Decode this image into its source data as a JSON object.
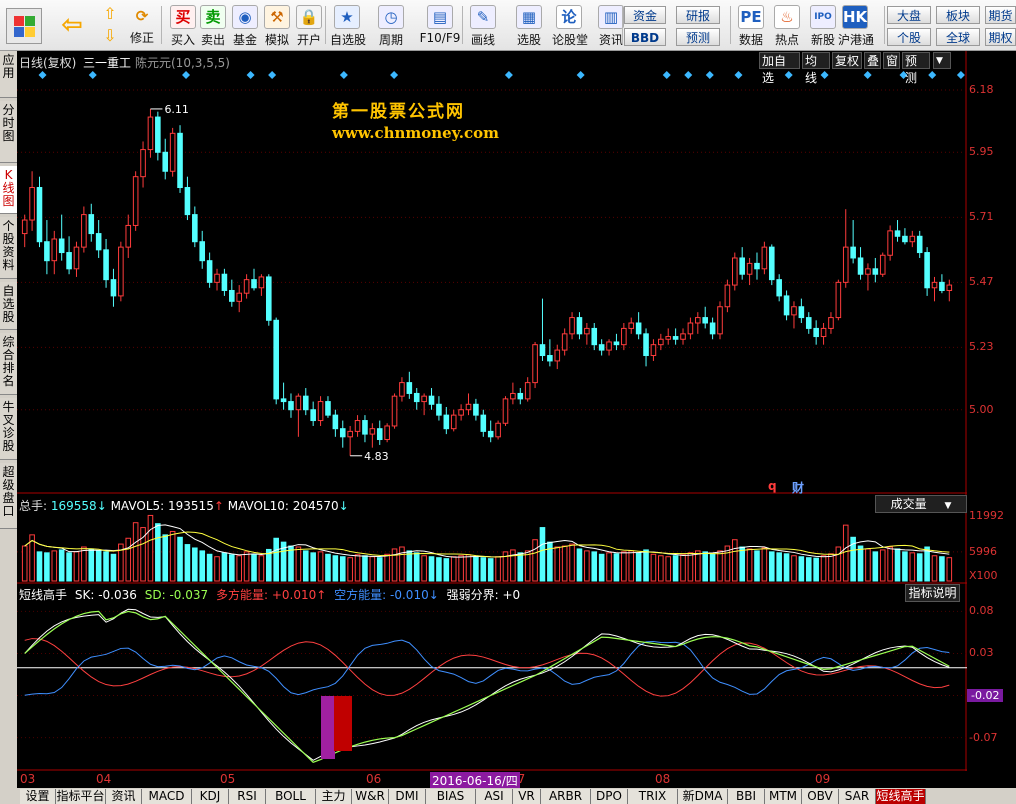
{
  "toolbar": {
    "buttons": [
      "买入",
      "卖出",
      "基金",
      "模拟",
      "开户",
      "自选股",
      "周期",
      "F10/F9",
      "画线",
      "选股",
      "论股堂",
      "资讯",
      "数据",
      "热点",
      "新股",
      "沪港通"
    ],
    "nav_labels": [
      "修正"
    ],
    "funds": "资金",
    "bbd": "BBD",
    "research": "研报",
    "forecast": "预测",
    "market": "大盘",
    "block": "板块",
    "single": "个股",
    "global": "全球",
    "futures": "期货",
    "futures2": "期权",
    "icons": [
      "back-icon",
      "up-icon",
      "down-icon",
      "refresh-icon"
    ]
  },
  "left_tabs": [
    "应用",
    "分时图",
    "K线图",
    "个股资料",
    "自选股",
    "综合排名",
    "牛叉诊股",
    "超级盘口"
  ],
  "header": {
    "period": "日线(复权)",
    "stock": "三一重工",
    "params": "陈元元(10,3,5,5)",
    "buttons": [
      "加自选",
      "均线",
      "复权",
      "叠",
      "窗",
      "预测"
    ]
  },
  "watermark": {
    "line1": "第一股票公式网",
    "line2": "www.chnmoney.com"
  },
  "price": {
    "high_label": "6.11",
    "low_label": "4.83",
    "ticks": [
      "6.18",
      "5.95",
      "5.71",
      "5.47",
      "5.23",
      "5.00"
    ],
    "markers": [
      "q",
      "财"
    ]
  },
  "volume": {
    "label_total": "总手:",
    "total": "169558",
    "mav5_label": "MAVOL5:",
    "mav5": "193515",
    "mav10_label": "MAVOL10:",
    "mav10": "204570",
    "selector": "成交量",
    "ticks": [
      "11992",
      "5996"
    ],
    "unit": "X100"
  },
  "indicator": {
    "name": "短线高手",
    "sk_label": "SK:",
    "sk": "-0.036",
    "sd_label": "SD:",
    "sd": "-0.037",
    "long_label": "多方能量:",
    "long": "+0.010",
    "short_label": "空方能量:",
    "short": "-0.010",
    "split_label": "强弱分界:",
    "split": "+0",
    "help": "指标说明",
    "ticks": [
      "0.08",
      "0.03",
      "-0.02",
      "-0.07"
    ],
    "current": "-0.02"
  },
  "dates": {
    "months": [
      "03",
      "04",
      "05",
      "06",
      "07",
      "08",
      "09"
    ],
    "cursor": "2016-06-16/四"
  },
  "bottom_tabs": [
    "设置",
    "指标平台",
    "资讯",
    "MACD",
    "KDJ",
    "RSI",
    "BOLL",
    "主力",
    "W&R",
    "DMI",
    "BIAS",
    "ASI",
    "VR",
    "ARBR",
    "DPO",
    "TRIX",
    "新DMA",
    "BBI",
    "MTM",
    "OBV",
    "SAR",
    "短线高手"
  ],
  "colors": {
    "up": "#ff3c3c",
    "down": "#54ffff",
    "sk": "#9bff53",
    "sd": "#ffffff",
    "long": "#ff4040",
    "short": "#3f8fff",
    "text_yellow": "#ffcc00"
  },
  "chart_data": {
    "type": "candlestick",
    "price_ylim": [
      4.7,
      6.25
    ],
    "candles": [
      [
        5.65,
        5.72,
        5.6,
        5.7
      ],
      [
        5.7,
        5.88,
        5.66,
        5.82
      ],
      [
        5.82,
        5.86,
        5.6,
        5.62
      ],
      [
        5.62,
        5.7,
        5.5,
        5.55
      ],
      [
        5.55,
        5.66,
        5.5,
        5.63
      ],
      [
        5.63,
        5.72,
        5.55,
        5.58
      ],
      [
        5.58,
        5.64,
        5.5,
        5.52
      ],
      [
        5.52,
        5.62,
        5.49,
        5.6
      ],
      [
        5.6,
        5.75,
        5.58,
        5.72
      ],
      [
        5.72,
        5.76,
        5.62,
        5.65
      ],
      [
        5.65,
        5.7,
        5.56,
        5.59
      ],
      [
        5.59,
        5.63,
        5.45,
        5.48
      ],
      [
        5.48,
        5.52,
        5.38,
        5.42
      ],
      [
        5.42,
        5.62,
        5.4,
        5.6
      ],
      [
        5.6,
        5.72,
        5.56,
        5.68
      ],
      [
        5.68,
        5.88,
        5.66,
        5.86
      ],
      [
        5.86,
        5.99,
        5.82,
        5.96
      ],
      [
        5.96,
        6.11,
        5.93,
        6.08
      ],
      [
        6.08,
        6.1,
        5.92,
        5.95
      ],
      [
        5.95,
        6.0,
        5.85,
        5.88
      ],
      [
        5.88,
        6.04,
        5.86,
        6.02
      ],
      [
        6.02,
        6.05,
        5.8,
        5.82
      ],
      [
        5.82,
        5.86,
        5.7,
        5.72
      ],
      [
        5.72,
        5.75,
        5.6,
        5.62
      ],
      [
        5.62,
        5.66,
        5.52,
        5.55
      ],
      [
        5.55,
        5.58,
        5.45,
        5.47
      ],
      [
        5.47,
        5.52,
        5.44,
        5.5
      ],
      [
        5.5,
        5.52,
        5.42,
        5.44
      ],
      [
        5.44,
        5.48,
        5.38,
        5.4
      ],
      [
        5.4,
        5.46,
        5.36,
        5.43
      ],
      [
        5.43,
        5.5,
        5.41,
        5.48
      ],
      [
        5.48,
        5.52,
        5.44,
        5.45
      ],
      [
        5.45,
        5.5,
        5.42,
        5.49
      ],
      [
        5.49,
        5.5,
        5.31,
        5.33
      ],
      [
        5.33,
        5.34,
        5.02,
        5.04
      ],
      [
        5.04,
        5.1,
        5.0,
        5.03
      ],
      [
        5.03,
        5.06,
        4.97,
        5.0
      ],
      [
        5.0,
        5.06,
        4.9,
        5.05
      ],
      [
        5.05,
        5.08,
        4.98,
        5.0
      ],
      [
        5.0,
        5.03,
        4.94,
        4.96
      ],
      [
        4.96,
        5.05,
        4.94,
        5.03
      ],
      [
        5.03,
        5.05,
        4.97,
        4.98
      ],
      [
        4.98,
        5.0,
        4.9,
        4.93
      ],
      [
        4.93,
        4.96,
        4.86,
        4.9
      ],
      [
        4.9,
        4.94,
        4.83,
        4.92
      ],
      [
        4.92,
        4.98,
        4.9,
        4.96
      ],
      [
        4.96,
        4.98,
        4.88,
        4.91
      ],
      [
        4.91,
        4.95,
        4.86,
        4.93
      ],
      [
        4.93,
        4.96,
        4.87,
        4.89
      ],
      [
        4.89,
        4.95,
        4.88,
        4.94
      ],
      [
        4.94,
        5.06,
        4.93,
        5.05
      ],
      [
        5.05,
        5.12,
        5.03,
        5.1
      ],
      [
        5.1,
        5.14,
        5.04,
        5.06
      ],
      [
        5.06,
        5.08,
        5.0,
        5.03
      ],
      [
        5.03,
        5.06,
        4.98,
        5.05
      ],
      [
        5.05,
        5.08,
        5.0,
        5.02
      ],
      [
        5.02,
        5.05,
        4.96,
        4.98
      ],
      [
        4.98,
        5.01,
        4.91,
        4.93
      ],
      [
        4.93,
        5.0,
        4.92,
        4.98
      ],
      [
        4.98,
        5.02,
        4.96,
        5.0
      ],
      [
        5.0,
        5.06,
        4.98,
        5.02
      ],
      [
        5.02,
        5.04,
        4.96,
        4.98
      ],
      [
        4.98,
        5.0,
        4.9,
        4.92
      ],
      [
        4.92,
        4.96,
        4.88,
        4.9
      ],
      [
        4.9,
        4.96,
        4.89,
        4.95
      ],
      [
        4.95,
        5.05,
        4.94,
        5.04
      ],
      [
        5.04,
        5.1,
        5.02,
        5.06
      ],
      [
        5.06,
        5.08,
        5.02,
        5.04
      ],
      [
        5.04,
        5.12,
        5.03,
        5.1
      ],
      [
        5.1,
        5.25,
        5.08,
        5.24
      ],
      [
        5.24,
        5.41,
        5.18,
        5.2
      ],
      [
        5.2,
        5.26,
        5.16,
        5.18
      ],
      [
        5.18,
        5.24,
        5.15,
        5.22
      ],
      [
        5.22,
        5.3,
        5.2,
        5.28
      ],
      [
        5.28,
        5.36,
        5.26,
        5.34
      ],
      [
        5.34,
        5.36,
        5.26,
        5.28
      ],
      [
        5.28,
        5.32,
        5.24,
        5.3
      ],
      [
        5.3,
        5.32,
        5.22,
        5.24
      ],
      [
        5.24,
        5.26,
        5.2,
        5.22
      ],
      [
        5.22,
        5.26,
        5.2,
        5.25
      ],
      [
        5.25,
        5.28,
        5.22,
        5.24
      ],
      [
        5.24,
        5.32,
        5.22,
        5.3
      ],
      [
        5.3,
        5.34,
        5.28,
        5.32
      ],
      [
        5.32,
        5.36,
        5.26,
        5.28
      ],
      [
        5.28,
        5.3,
        5.16,
        5.2
      ],
      [
        5.2,
        5.26,
        5.18,
        5.24
      ],
      [
        5.24,
        5.28,
        5.22,
        5.26
      ],
      [
        5.26,
        5.3,
        5.24,
        5.27
      ],
      [
        5.27,
        5.3,
        5.24,
        5.26
      ],
      [
        5.26,
        5.3,
        5.24,
        5.28
      ],
      [
        5.28,
        5.34,
        5.26,
        5.32
      ],
      [
        5.32,
        5.36,
        5.28,
        5.34
      ],
      [
        5.34,
        5.38,
        5.3,
        5.32
      ],
      [
        5.32,
        5.34,
        5.26,
        5.28
      ],
      [
        5.28,
        5.4,
        5.26,
        5.38
      ],
      [
        5.38,
        5.48,
        5.36,
        5.46
      ],
      [
        5.46,
        5.58,
        5.44,
        5.56
      ],
      [
        5.56,
        5.6,
        5.48,
        5.5
      ],
      [
        5.5,
        5.56,
        5.46,
        5.54
      ],
      [
        5.54,
        5.58,
        5.48,
        5.52
      ],
      [
        5.52,
        5.62,
        5.5,
        5.6
      ],
      [
        5.6,
        5.61,
        5.46,
        5.48
      ],
      [
        5.48,
        5.5,
        5.4,
        5.42
      ],
      [
        5.42,
        5.44,
        5.33,
        5.35
      ],
      [
        5.35,
        5.4,
        5.3,
        5.38
      ],
      [
        5.38,
        5.41,
        5.32,
        5.34
      ],
      [
        5.34,
        5.36,
        5.28,
        5.3
      ],
      [
        5.3,
        5.33,
        5.24,
        5.27
      ],
      [
        5.27,
        5.32,
        5.24,
        5.3
      ],
      [
        5.3,
        5.36,
        5.28,
        5.34
      ],
      [
        5.34,
        5.48,
        5.33,
        5.47
      ],
      [
        5.47,
        5.74,
        5.45,
        5.6
      ],
      [
        5.6,
        5.7,
        5.54,
        5.56
      ],
      [
        5.56,
        5.6,
        5.48,
        5.5
      ],
      [
        5.5,
        5.54,
        5.44,
        5.52
      ],
      [
        5.52,
        5.56,
        5.47,
        5.5
      ],
      [
        5.5,
        5.58,
        5.49,
        5.57
      ],
      [
        5.57,
        5.68,
        5.55,
        5.66
      ],
      [
        5.66,
        5.7,
        5.62,
        5.64
      ],
      [
        5.64,
        5.67,
        5.61,
        5.62
      ],
      [
        5.62,
        5.66,
        5.6,
        5.64
      ],
      [
        5.64,
        5.66,
        5.56,
        5.58
      ],
      [
        5.58,
        5.6,
        5.42,
        5.45
      ],
      [
        5.45,
        5.49,
        5.4,
        5.47
      ],
      [
        5.47,
        5.5,
        5.43,
        5.44
      ],
      [
        5.44,
        5.48,
        5.4,
        5.46
      ]
    ],
    "volume": [
      72,
      95,
      60,
      58,
      62,
      64,
      58,
      60,
      70,
      66,
      62,
      60,
      55,
      76,
      88,
      120,
      110,
      135,
      118,
      95,
      102,
      90,
      75,
      68,
      62,
      55,
      50,
      58,
      54,
      52,
      60,
      55,
      52,
      65,
      88,
      80,
      72,
      70,
      62,
      58,
      60,
      55,
      52,
      50,
      48,
      54,
      52,
      50,
      48,
      55,
      66,
      70,
      62,
      58,
      52,
      50,
      48,
      46,
      50,
      52,
      54,
      50,
      48,
      46,
      50,
      60,
      64,
      58,
      62,
      85,
      110,
      80,
      70,
      72,
      76,
      66,
      62,
      60,
      55,
      58,
      56,
      60,
      62,
      58,
      64,
      55,
      52,
      50,
      52,
      54,
      58,
      62,
      60,
      56,
      62,
      72,
      85,
      70,
      66,
      62,
      68,
      60,
      58,
      56,
      52,
      50,
      48,
      47,
      52,
      56,
      70,
      115,
      90,
      72,
      66,
      60,
      64,
      70,
      66,
      60,
      58,
      56,
      70,
      52,
      50,
      48
    ],
    "volume_ylim": [
      0,
      12500
    ],
    "indicator_ylim": [
      -0.105,
      0.09
    ]
  }
}
